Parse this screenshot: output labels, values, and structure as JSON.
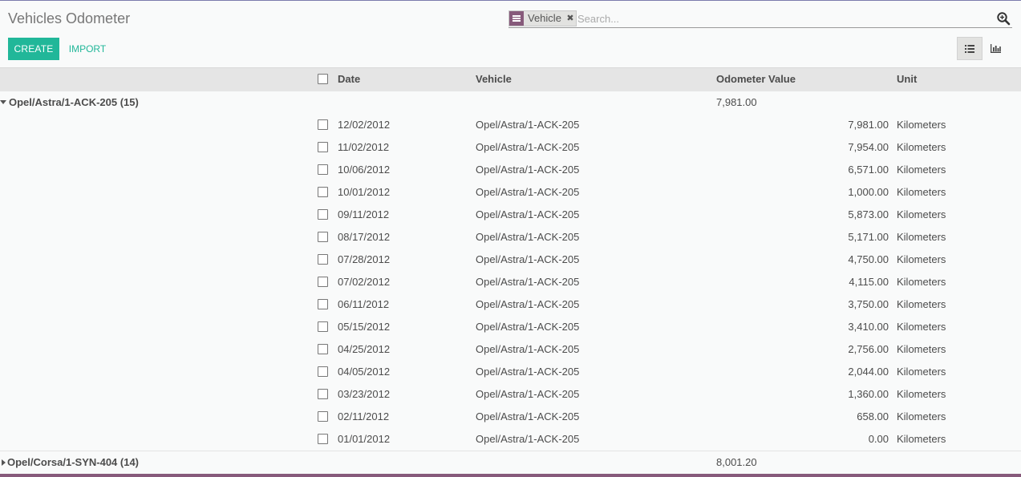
{
  "page": {
    "title": "Vehicles Odometer"
  },
  "search": {
    "facet": "Vehicle",
    "placeholder": "Search..."
  },
  "buttons": {
    "create": "CREATE",
    "import": "IMPORT"
  },
  "table": {
    "headers": {
      "date": "Date",
      "vehicle": "Vehicle",
      "odometer": "Odometer Value",
      "unit": "Unit"
    }
  },
  "groups": [
    {
      "name": "Opel/Astra/1-ACK-205 (15)",
      "total": "7,981.00",
      "expanded": true,
      "rows": [
        {
          "date": "12/02/2012",
          "vehicle": "Opel/Astra/1-ACK-205",
          "odometer": "7,981.00",
          "unit": "Kilometers"
        },
        {
          "date": "11/02/2012",
          "vehicle": "Opel/Astra/1-ACK-205",
          "odometer": "7,954.00",
          "unit": "Kilometers"
        },
        {
          "date": "10/06/2012",
          "vehicle": "Opel/Astra/1-ACK-205",
          "odometer": "6,571.00",
          "unit": "Kilometers"
        },
        {
          "date": "10/01/2012",
          "vehicle": "Opel/Astra/1-ACK-205",
          "odometer": "1,000.00",
          "unit": "Kilometers"
        },
        {
          "date": "09/11/2012",
          "vehicle": "Opel/Astra/1-ACK-205",
          "odometer": "5,873.00",
          "unit": "Kilometers"
        },
        {
          "date": "08/17/2012",
          "vehicle": "Opel/Astra/1-ACK-205",
          "odometer": "5,171.00",
          "unit": "Kilometers"
        },
        {
          "date": "07/28/2012",
          "vehicle": "Opel/Astra/1-ACK-205",
          "odometer": "4,750.00",
          "unit": "Kilometers"
        },
        {
          "date": "07/02/2012",
          "vehicle": "Opel/Astra/1-ACK-205",
          "odometer": "4,115.00",
          "unit": "Kilometers"
        },
        {
          "date": "06/11/2012",
          "vehicle": "Opel/Astra/1-ACK-205",
          "odometer": "3,750.00",
          "unit": "Kilometers"
        },
        {
          "date": "05/15/2012",
          "vehicle": "Opel/Astra/1-ACK-205",
          "odometer": "3,410.00",
          "unit": "Kilometers"
        },
        {
          "date": "04/25/2012",
          "vehicle": "Opel/Astra/1-ACK-205",
          "odometer": "2,756.00",
          "unit": "Kilometers"
        },
        {
          "date": "04/05/2012",
          "vehicle": "Opel/Astra/1-ACK-205",
          "odometer": "2,044.00",
          "unit": "Kilometers"
        },
        {
          "date": "03/23/2012",
          "vehicle": "Opel/Astra/1-ACK-205",
          "odometer": "1,360.00",
          "unit": "Kilometers"
        },
        {
          "date": "02/11/2012",
          "vehicle": "Opel/Astra/1-ACK-205",
          "odometer": "658.00",
          "unit": "Kilometers"
        },
        {
          "date": "01/01/2012",
          "vehicle": "Opel/Astra/1-ACK-205",
          "odometer": "0.00",
          "unit": "Kilometers"
        }
      ]
    },
    {
      "name": "Opel/Corsa/1-SYN-404 (14)",
      "total": "8,001.20",
      "expanded": false,
      "rows": []
    }
  ]
}
